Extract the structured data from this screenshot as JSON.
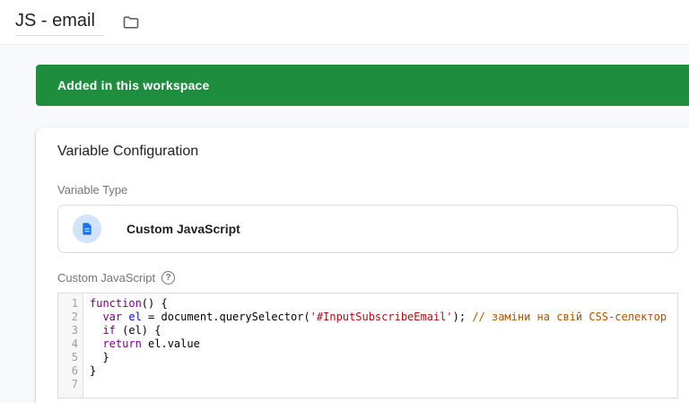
{
  "header": {
    "title": "JS - email"
  },
  "banner": {
    "text": "Added in this workspace",
    "color": "#1e8e3e"
  },
  "card": {
    "title": "Variable Configuration",
    "variable_type_label": "Variable Type",
    "variable_type_name": "Custom JavaScript",
    "code_field_label": "Custom JavaScript",
    "help_glyph": "?"
  },
  "code_editor": {
    "token_colors": {
      "k": "#770088",
      "d": "#0000ff",
      "s": "#aa1111",
      "c": "#aa5500",
      "p": "#000000"
    },
    "lines": [
      [
        {
          "t": "function",
          "c": "k"
        },
        {
          "t": "() {",
          "c": "p"
        }
      ],
      [
        {
          "t": "  ",
          "c": "p"
        },
        {
          "t": "var",
          "c": "k"
        },
        {
          "t": " ",
          "c": "p"
        },
        {
          "t": "el",
          "c": "d"
        },
        {
          "t": " = document.querySelector(",
          "c": "p"
        },
        {
          "t": "'#InputSubscribeEmail'",
          "c": "s"
        },
        {
          "t": "); ",
          "c": "p"
        },
        {
          "t": "// заміни на свій CSS-селектор",
          "c": "c"
        }
      ],
      [
        {
          "t": "  ",
          "c": "p"
        },
        {
          "t": "if",
          "c": "k"
        },
        {
          "t": " (el) {",
          "c": "p"
        }
      ],
      [
        {
          "t": "  ",
          "c": "p"
        },
        {
          "t": "return",
          "c": "k"
        },
        {
          "t": " el.value",
          "c": "p"
        }
      ],
      [
        {
          "t": "  }",
          "c": "p"
        }
      ],
      [
        {
          "t": "}",
          "c": "p"
        }
      ],
      []
    ]
  }
}
